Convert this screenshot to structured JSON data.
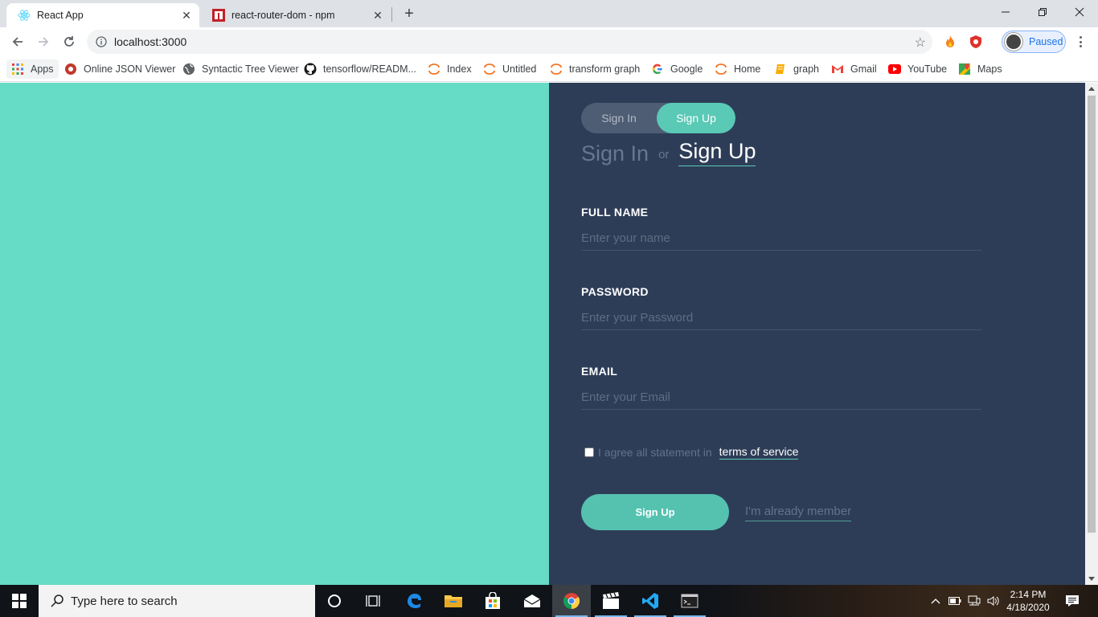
{
  "browser": {
    "tabs": [
      {
        "title": "React App",
        "active": true
      },
      {
        "title": "react-router-dom - npm",
        "active": false
      }
    ],
    "url": "localhost:3000",
    "profile_status": "Paused",
    "bookmarks": [
      {
        "label": "Apps",
        "icon": "apps-grid-icon"
      },
      {
        "label": "Online JSON Viewer",
        "icon": "json-viewer-icon"
      },
      {
        "label": "Syntactic Tree Viewer",
        "icon": "globe-icon"
      },
      {
        "label": "tensorflow/READM...",
        "icon": "github-icon"
      },
      {
        "label": "Index",
        "icon": "jupyter-icon"
      },
      {
        "label": "Untitled",
        "icon": "jupyter-icon"
      },
      {
        "label": "transform graph",
        "icon": "jupyter-icon"
      },
      {
        "label": "Google",
        "icon": "google-icon"
      },
      {
        "label": "Home",
        "icon": "jupyter-icon"
      },
      {
        "label": "graph",
        "icon": "notebook-icon"
      },
      {
        "label": "Gmail",
        "icon": "gmail-icon"
      },
      {
        "label": "YouTube",
        "icon": "youtube-icon"
      },
      {
        "label": "Maps",
        "icon": "maps-icon"
      }
    ]
  },
  "app": {
    "switch": {
      "sign_in": "Sign In",
      "sign_up": "Sign Up",
      "selected": "sign_up"
    },
    "heading": {
      "sign_in": "Sign In",
      "or": "or",
      "sign_up": "Sign Up"
    },
    "fields": {
      "full_name": {
        "label": "FULL NAME",
        "placeholder": "Enter your name",
        "value": ""
      },
      "password": {
        "label": "PASSWORD",
        "placeholder": "Enter your Password",
        "value": ""
      },
      "email": {
        "label": "EMAIL",
        "placeholder": "Enter your Email",
        "value": ""
      }
    },
    "agree_text": "I agree all statement in",
    "terms_link": "terms of service",
    "agree_checked": false,
    "submit_label": "Sign Up",
    "member_link": "I'm already member",
    "colors": {
      "left_panel": "#66dbc6",
      "right_panel": "#2e3d57",
      "accent": "#55c2b0"
    }
  },
  "taskbar": {
    "search_placeholder": "Type here to search",
    "time": "2:14 PM",
    "date": "4/18/2020"
  }
}
